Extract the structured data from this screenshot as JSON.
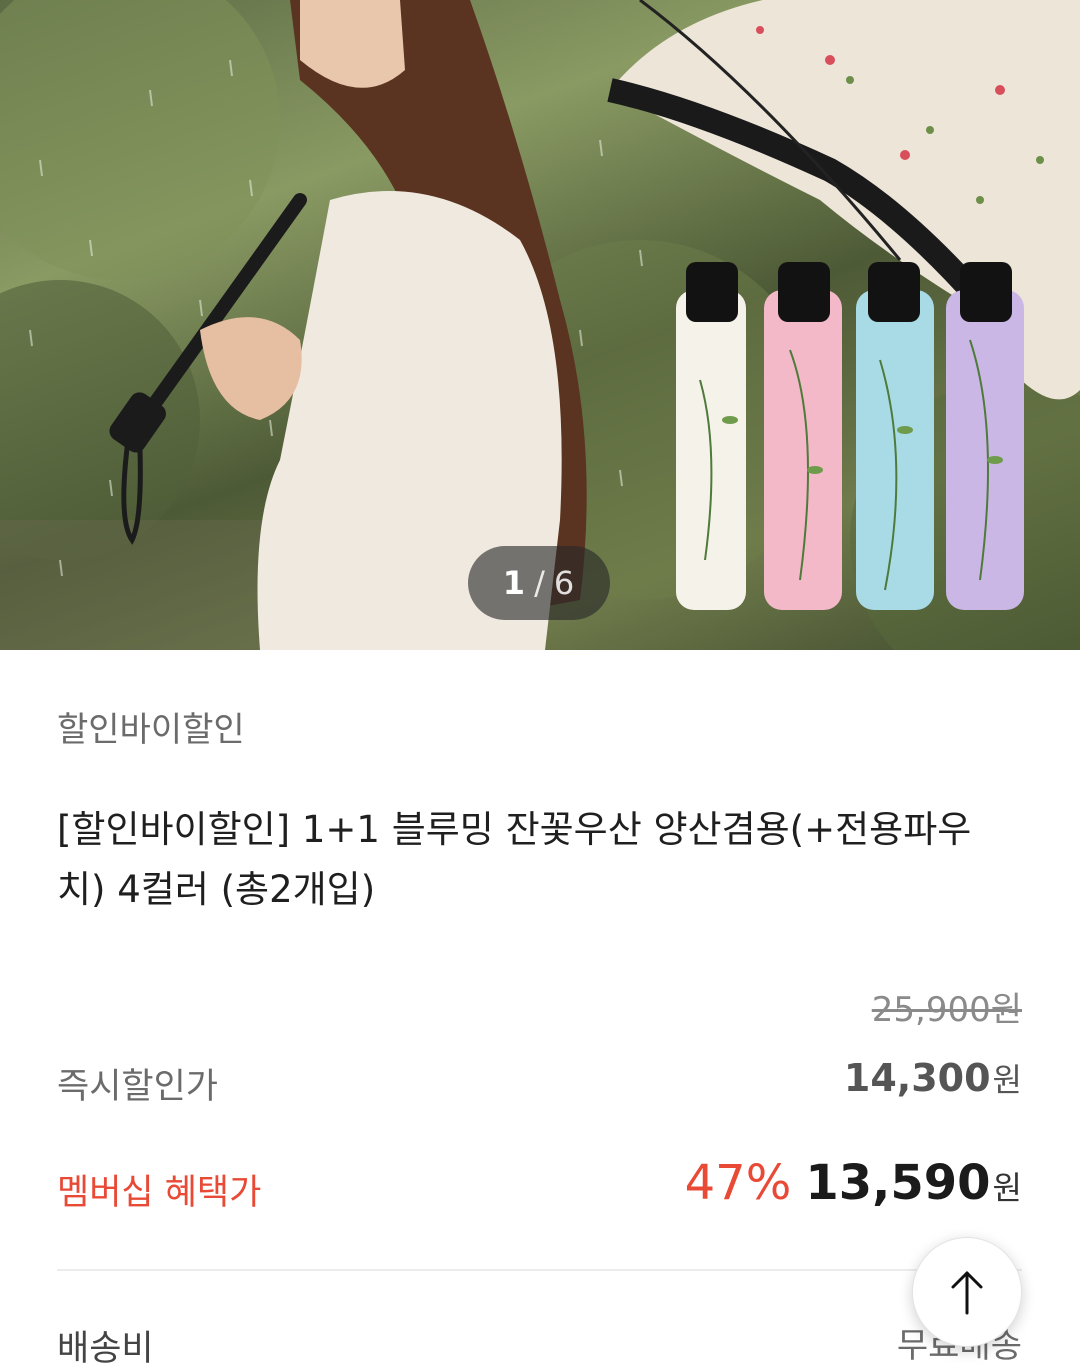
{
  "gallery": {
    "current": "1",
    "separator": "/",
    "total": "6",
    "image_alt": "woman holding floral umbrella with four folded umbrellas"
  },
  "product": {
    "brand": "할인바이할인",
    "title": "[할인바이할인] 1+1 블루밍 잔꽃우산 양산겸용(+전용파우치) 4컬러 (총2개입)"
  },
  "pricing": {
    "original_price": "25,900원",
    "instant_label": "즉시할인가",
    "instant_amount": "14,300",
    "membership_label": "멤버십 혜택가",
    "membership_discount": "47%",
    "membership_amount": "13,590",
    "currency": "원"
  },
  "shipping": {
    "label": "배송비",
    "value": "무료배송"
  },
  "colors": {
    "accent_red": "#e84a36",
    "umbrella_white": "#f5f2ea",
    "umbrella_pink": "#f3b9c8",
    "umbrella_blue": "#a9dbe6",
    "umbrella_purple": "#cbb7e6"
  },
  "icons": {
    "scroll_top": "arrow-up-icon"
  }
}
